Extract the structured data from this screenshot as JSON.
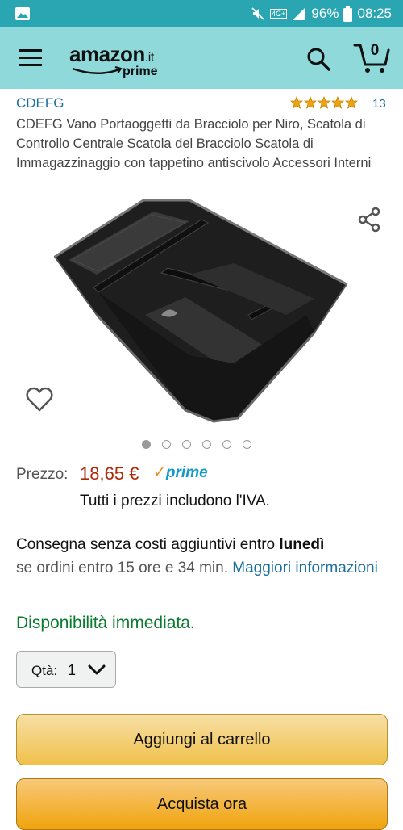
{
  "status_bar": {
    "battery_percent": "96%",
    "time": "08:25",
    "network_badge": "4G+"
  },
  "header": {
    "logo_word": "amazon",
    "logo_tld": ".it",
    "logo_sub": "prime",
    "cart_count": "0"
  },
  "product": {
    "brand": "CDEFG",
    "rating_stars": 5,
    "rating_count": "13",
    "title": "CDEFG Vano Portaoggetti da Bracciolo per Niro, Scatola di Controllo Centrale Scatola del Bracciolo Scatola di Immagazzinaggio con tappetino antiscivolo Accessori Interni",
    "image_count": 6,
    "active_image": 1
  },
  "pricing": {
    "label": "Prezzo:",
    "price": "18,65 €",
    "prime_check": "✓",
    "prime_label": "prime",
    "vat_note": "Tutti i prezzi includono l'IVA."
  },
  "delivery": {
    "text_main": "Consegna senza costi aggiuntivi entro ",
    "day": "lunedì",
    "text_order": "se ordini entro 15 ore e 34 min. ",
    "link": "Maggiori informazioni"
  },
  "availability": "Disponibilità immediata.",
  "quantity": {
    "label": "Qtà:",
    "value": "1"
  },
  "buttons": {
    "add_to_cart": "Aggiungi al carrello",
    "buy_now": "Acquista ora"
  },
  "colors": {
    "status_bar": "#2aa6b2",
    "app_bar": "#8fd9da",
    "link": "#1a6f9e",
    "price": "#b12704",
    "availability": "#0a7a2e",
    "star": "#f0a30c"
  }
}
